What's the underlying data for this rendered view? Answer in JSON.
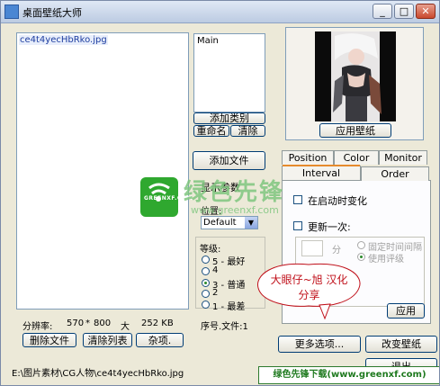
{
  "window": {
    "title": "桌面壁纸大师",
    "minimize": "_",
    "maximize": "□",
    "close": "✕"
  },
  "file_list": {
    "items": [
      "ce4t4yecHbRko.jpg"
    ]
  },
  "categories": {
    "items": [
      "Main"
    ],
    "add_label": "添加类别",
    "rename_label": "重命名",
    "clear_label": "清除"
  },
  "preview": {
    "apply_label": "应用壁纸"
  },
  "left_controls": {
    "add_file_label": "添加文件",
    "display_label": "显示参数",
    "position_label": "位置:",
    "position_value": "Default",
    "level_label": "等级:",
    "levels": [
      "5 - 最好",
      "4",
      "3 - 普通",
      "2",
      "1 - 最差"
    ],
    "selected_level": 2
  },
  "status": {
    "resolution_label": "分辨率:",
    "width": "570",
    "times": "*",
    "height": "800",
    "size_label": "大",
    "size_value": "252 KB",
    "index_text": "序号.文件:1"
  },
  "bottom_left": {
    "delete_label": "删除文件",
    "clear_list_label": "清除列表",
    "misc_label": "杂项."
  },
  "path": "E:\\图片素材\\CG人物\\ce4t4yecHbRko.jpg",
  "tabs": {
    "row1": [
      "Position",
      "Color",
      "Monitor"
    ],
    "row2": [
      "Interval",
      "Order"
    ],
    "active": "Interval"
  },
  "interval": {
    "startup_label": "在启动时变化",
    "update_label": "更新一次:",
    "minutes_unit": "分",
    "fixed_label": "固定时间间隔",
    "use_level_label": "使用评级",
    "apply_label": "应用"
  },
  "bottom_right": {
    "more_label": "更多选项...",
    "change_label": "改变壁纸",
    "cut_label": "退出"
  },
  "overlay": {
    "watermark_cn": "绿色先锋",
    "watermark_url": "www.greenxf.com",
    "watermark_logo": "GREENXF.COM",
    "callout_line1": "大眼仔~旭 汉化",
    "callout_line2": "分享",
    "banner": "绿色先锋下载(www.greenxf.com)"
  },
  "colors": {
    "accent": "#e68b2c",
    "banner_green": "#1f7a1f",
    "callout_red": "#c0101a"
  }
}
